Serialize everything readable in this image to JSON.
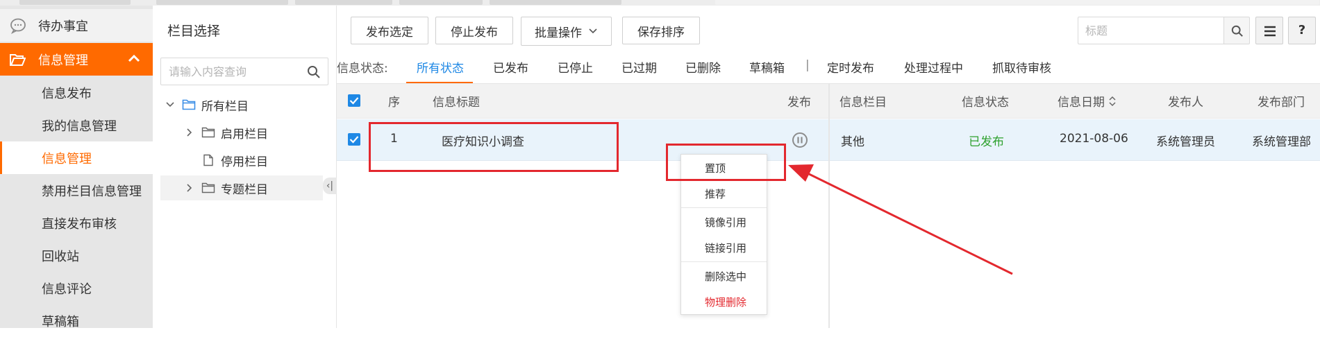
{
  "sidebar": {
    "todo": "待办事宜",
    "group": "信息管理",
    "items": [
      "信息发布",
      "我的信息管理",
      "信息管理",
      "禁用栏目信息管理",
      "直接发布审核",
      "回收站",
      "信息评论",
      "草稿箱"
    ],
    "active_index": 2
  },
  "tree": {
    "title": "栏目选择",
    "search_placeholder": "请输入内容查询",
    "root": "所有栏目",
    "children": [
      "启用栏目",
      "停用栏目",
      "专题栏目"
    ]
  },
  "toolbar": {
    "publish_selected": "发布选定",
    "stop_publish": "停止发布",
    "batch_ops": "批量操作",
    "save_order": "保存排序",
    "title_placeholder": "标题"
  },
  "status_filter": {
    "label": "信息状态:",
    "options": [
      "所有状态",
      "已发布",
      "已停止",
      "已过期",
      "已删除",
      "草稿箱"
    ],
    "separator": "|",
    "extra": [
      "定时发布",
      "处理过程中",
      "抓取待审核"
    ],
    "active": "所有状态"
  },
  "table": {
    "columns": [
      "序",
      "信息标题",
      "发布",
      "信息栏目",
      "信息状态",
      "信息日期",
      "发布人",
      "发布部门"
    ],
    "rows": [
      {
        "seq": "1",
        "title": "医疗知识小调查",
        "column": "其他",
        "status": "已发布",
        "date": "2021-08-06",
        "publisher": "系统管理员",
        "dept": "系统管理部"
      }
    ]
  },
  "context_menu": {
    "items": [
      "置顶",
      "推荐",
      "镜像引用",
      "链接引用",
      "删除选中",
      "物理删除"
    ]
  },
  "colors": {
    "accent": "#ff6a00",
    "checkbox": "#1e88e5",
    "status_published": "#2ea12e",
    "danger": "#e3282e",
    "annotation": "#e3282e"
  }
}
